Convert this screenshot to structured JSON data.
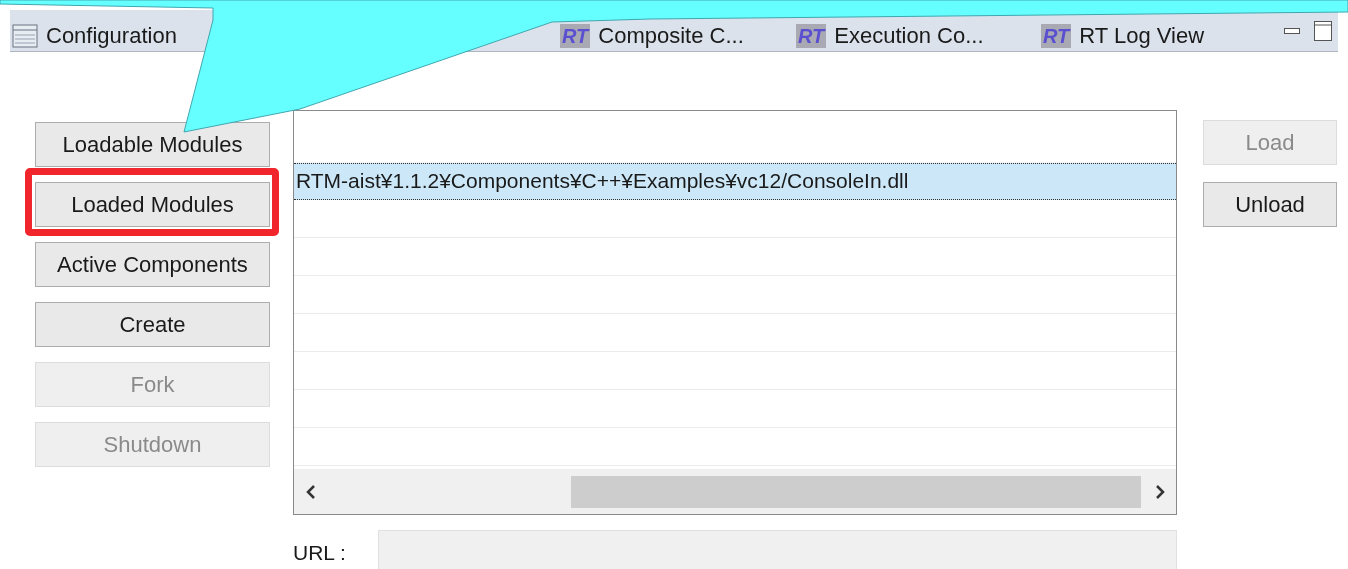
{
  "tabs": [
    {
      "label": "Configuration",
      "icon": {
        "kind": "table"
      }
    },
    {
      "label": "Composite C...",
      "icon": {
        "kind": "rt",
        "text": "RT"
      }
    },
    {
      "label": "Execution Co...",
      "icon": {
        "kind": "rt",
        "text": "RT"
      }
    },
    {
      "label": "RT Log View",
      "icon": {
        "kind": "rt",
        "text": "RT"
      }
    }
  ],
  "left_buttons": [
    {
      "label": "Loadable Modules",
      "disabled": false,
      "highlighted": false
    },
    {
      "label": "Loaded Modules",
      "disabled": false,
      "highlighted": true
    },
    {
      "label": "Active Components",
      "disabled": false,
      "highlighted": false
    },
    {
      "label": "Create",
      "disabled": false,
      "highlighted": false
    },
    {
      "label": "Fork",
      "disabled": true,
      "highlighted": false
    },
    {
      "label": "Shutdown",
      "disabled": true,
      "highlighted": false
    }
  ],
  "modules": [
    {
      "text": "RTM-aist¥1.1.2¥Components¥C++¥Examples¥vc12/ConsoleIn.dll",
      "selected": true
    }
  ],
  "right_buttons": [
    {
      "label": "Load",
      "disabled": true
    },
    {
      "label": "Unload",
      "disabled": false
    }
  ],
  "url": {
    "label": "URL :"
  }
}
